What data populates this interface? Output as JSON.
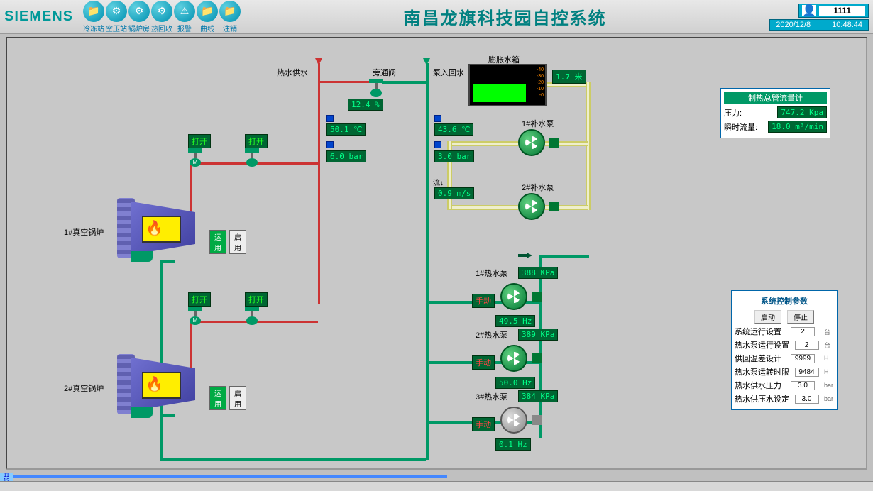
{
  "header": {
    "logo": "SIEMENS",
    "title": "南昌龙旗科技园自控系统",
    "nav": [
      {
        "label": "冷冻站",
        "icon": "📁"
      },
      {
        "label": "空压站",
        "icon": "⚙"
      },
      {
        "label": "锅炉房",
        "icon": "⚙"
      },
      {
        "label": "热回收",
        "icon": "⚙"
      },
      {
        "label": "报警",
        "icon": "⚠"
      },
      {
        "label": "曲线",
        "icon": "📁"
      },
      {
        "label": "注销",
        "icon": "📁"
      }
    ],
    "user_id": "1111",
    "date": "2020/12/8",
    "time": "10:48:44"
  },
  "labels": {
    "boiler1": "1#真空锅炉",
    "boiler2": "2#真空锅炉",
    "running": "运用",
    "start": "启用",
    "open1": "打开",
    "open2": "打开",
    "open3": "打开",
    "open4": "打开",
    "hot_supply": "热水供水",
    "bypass": "旁通阀",
    "return": "泵入回水",
    "exp_tank": "膨胀水箱",
    "makeup1": "1#补水泵",
    "makeup2": "2#补水泵",
    "hotpump1": "1#热水泵",
    "hotpump2": "2#热水泵",
    "hotpump3": "3#热水泵",
    "manual1": "手动",
    "manual2": "手动",
    "manual3": "手动",
    "flow_label": "流↓"
  },
  "values": {
    "bypass_pct": "12.4  %",
    "supply_temp": "50.1 ℃",
    "supply_press": "6.0  bar",
    "return_temp": "43.6 ℃",
    "return_press": "3.0  bar",
    "return_flow": "0.9  m/s",
    "tank_level": "1.7  米",
    "p1_kpa": "388 KPa",
    "p1_hz": "49.5  Hz",
    "p2_kpa": "389 KPa",
    "p2_hz": "50.0  Hz",
    "p3_kpa": "384 KPa",
    "p3_hz": "0.1  Hz"
  },
  "meter": {
    "title": "制热总管流量计",
    "press_label": "压力:",
    "press_val": "747.2  Kpa",
    "flow_label": "瞬时流量:",
    "flow_val": "18.0  m³/min"
  },
  "control": {
    "title": "系统控制参数",
    "btn_start": "启动",
    "btn_stop": "停止",
    "rows": [
      {
        "label": "系统运行设置",
        "val": "2",
        "unit": "台"
      },
      {
        "label": "热水泵运行设置",
        "val": "2",
        "unit": "台"
      },
      "",
      {
        "label": "供回温差设计",
        "val": "9999",
        "unit": "H"
      },
      {
        "label": "热水泵运转时限",
        "val": "9484",
        "unit": "H"
      },
      {
        "label": "热水供水压力",
        "val": "3.0",
        "unit": "bar"
      },
      {
        "label": "热水供压水设定",
        "val": "3.0",
        "unit": "bar"
      }
    ]
  },
  "tank_scale": [
    "-40",
    "-30",
    "-20",
    "-10",
    "-0"
  ]
}
